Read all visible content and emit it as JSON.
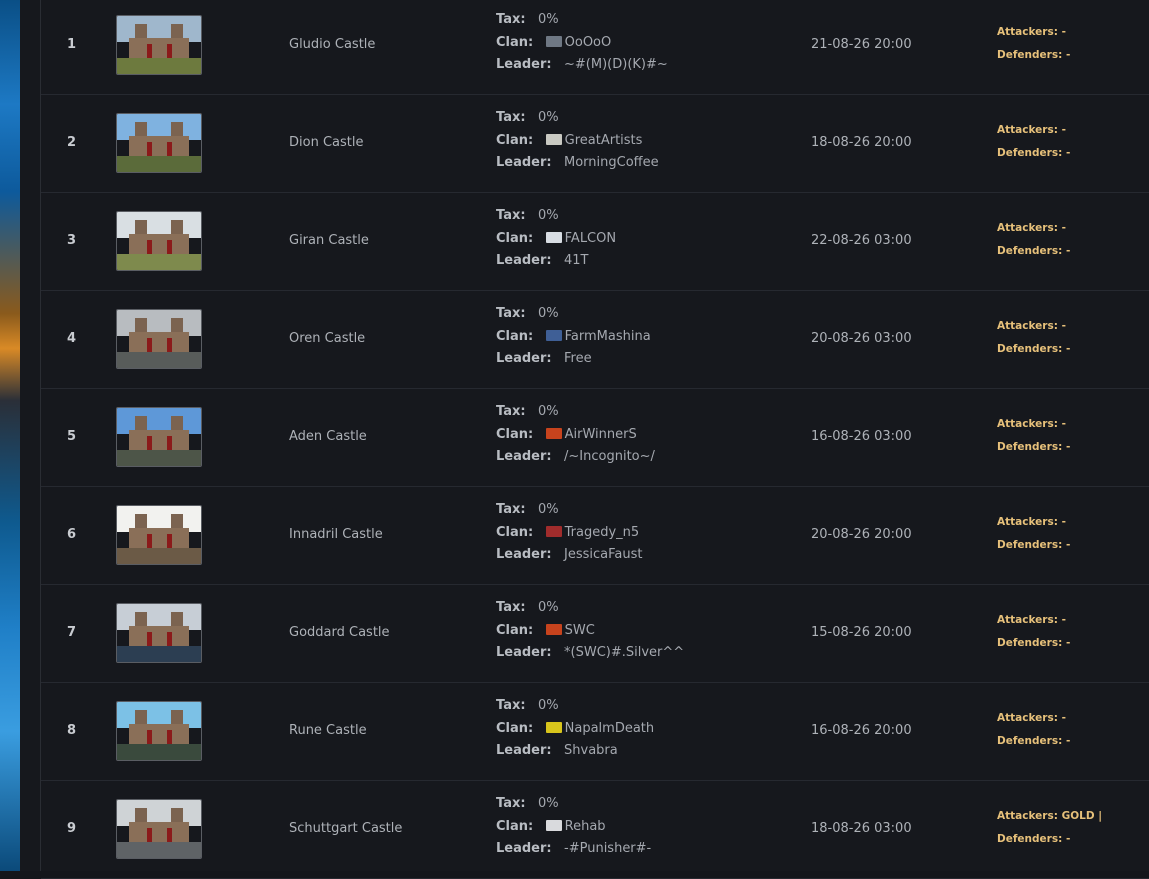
{
  "colors": {
    "background": "#14161b",
    "siege_text": "#e6c07a",
    "row_border": "#262930"
  },
  "labels": {
    "tax": "Tax:",
    "clan": "Clan:",
    "leader": "Leader:",
    "attackers": "Attackers:",
    "defenders": "Defenders:"
  },
  "castles": [
    {
      "rank": "1",
      "name": "Gludio Castle",
      "tax": "0%",
      "clan": "OoOoO",
      "clan_icon_color": "#6f7884",
      "leader": "~#(M)(D)(K)#~",
      "siege_date": "21-08-26 20:00",
      "attackers": "-",
      "defenders": "-",
      "sky": "#9fb7cc",
      "ground": "#6d7a3e"
    },
    {
      "rank": "2",
      "name": "Dion Castle",
      "tax": "0%",
      "clan": "GreatArtists",
      "clan_icon_color": "#c9c9c2",
      "leader": "MorningCoffee",
      "siege_date": "18-08-26 20:00",
      "attackers": "-",
      "defenders": "-",
      "sky": "#7fb2e0",
      "ground": "#5b6b3a"
    },
    {
      "rank": "3",
      "name": "Giran Castle",
      "tax": "0%",
      "clan": "FALCON",
      "clan_icon_color": "#d8dde3",
      "leader": "41T",
      "siege_date": "22-08-26 03:00",
      "attackers": "-",
      "defenders": "-",
      "sky": "#d9dfe3",
      "ground": "#7e8a4d"
    },
    {
      "rank": "4",
      "name": "Oren Castle",
      "tax": "0%",
      "clan": "FarmMashina",
      "clan_icon_color": "#3f5f96",
      "leader": "Free",
      "siege_date": "20-08-26 03:00",
      "attackers": "-",
      "defenders": "-",
      "sky": "#b8bcc0",
      "ground": "#585c5a"
    },
    {
      "rank": "5",
      "name": "Aden Castle",
      "tax": "0%",
      "clan": "AirWinnerS",
      "clan_icon_color": "#c7431d",
      "leader": "/~Incognito~/",
      "siege_date": "16-08-26 03:00",
      "attackers": "-",
      "defenders": "-",
      "sky": "#5e98d8",
      "ground": "#4d5548"
    },
    {
      "rank": "6",
      "name": "Innadril Castle",
      "tax": "0%",
      "clan": "Tragedy_n5",
      "clan_icon_color": "#a12c2c",
      "leader": "JessicaFaust",
      "siege_date": "20-08-26 20:00",
      "attackers": "-",
      "defenders": "-",
      "sky": "#f2f2ef",
      "ground": "#6b5a46"
    },
    {
      "rank": "7",
      "name": "Goddard Castle",
      "tax": "0%",
      "clan": "SWC",
      "clan_icon_color": "#c7431d",
      "leader": "*(SWC)#.Silver^^",
      "siege_date": "15-08-26 20:00",
      "attackers": "-",
      "defenders": "-",
      "sky": "#c7ced6",
      "ground": "#2c3e52"
    },
    {
      "rank": "8",
      "name": "Rune Castle",
      "tax": "0%",
      "clan": "NapalmDeath",
      "clan_icon_color": "#d8c51c",
      "leader": "Shvabra",
      "siege_date": "16-08-26 20:00",
      "attackers": "-",
      "defenders": "-",
      "sky": "#7cc1e6",
      "ground": "#3a4a3d"
    },
    {
      "rank": "9",
      "name": "Schuttgart Castle",
      "tax": "0%",
      "clan": "Rehab",
      "clan_icon_color": "#d9dadd",
      "leader": "-#Punisher#-",
      "siege_date": "18-08-26 03:00",
      "attackers": "GOLD |",
      "defenders": "-",
      "sky": "#cfd3d6",
      "ground": "#5f6366"
    }
  ]
}
